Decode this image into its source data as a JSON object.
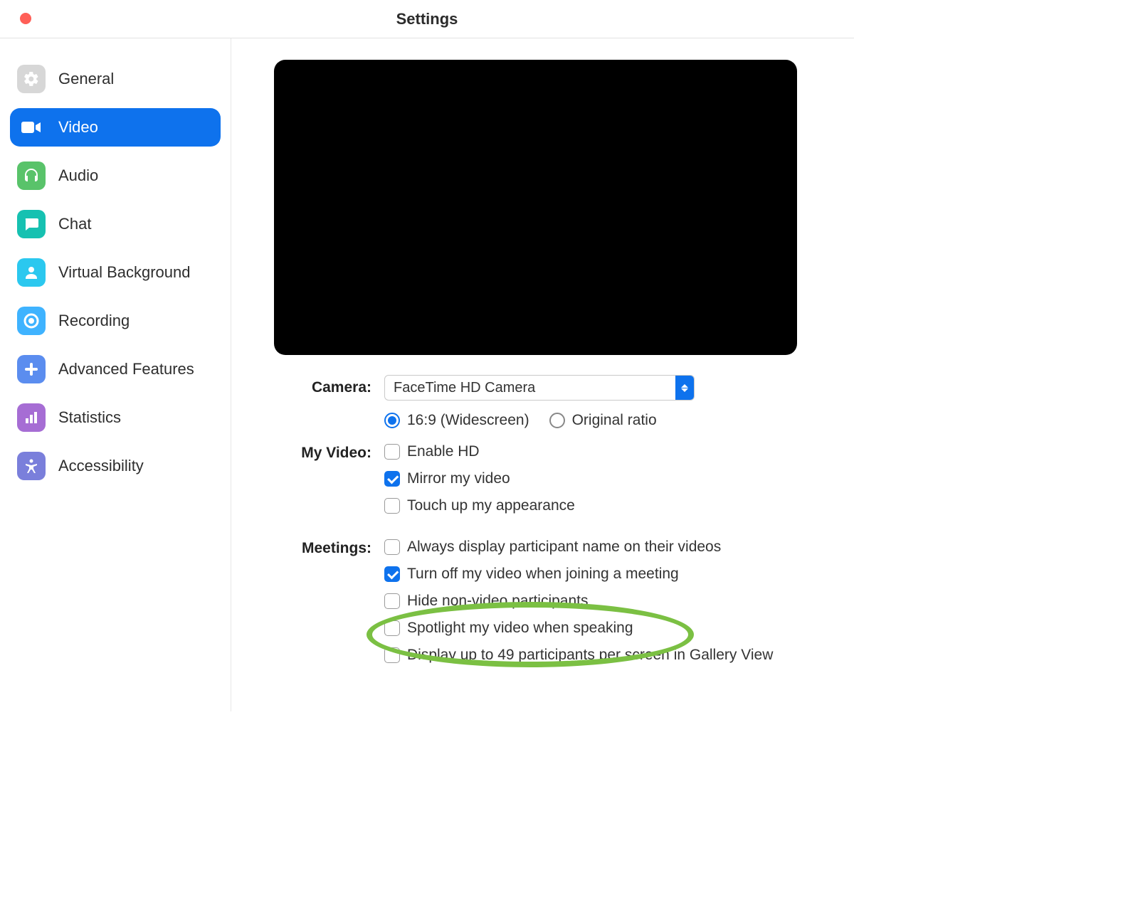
{
  "window": {
    "title": "Settings"
  },
  "sidebar": {
    "items": [
      {
        "label": "General"
      },
      {
        "label": "Video"
      },
      {
        "label": "Audio"
      },
      {
        "label": "Chat"
      },
      {
        "label": "Virtual Background"
      },
      {
        "label": "Recording"
      },
      {
        "label": "Advanced Features"
      },
      {
        "label": "Statistics"
      },
      {
        "label": "Accessibility"
      }
    ]
  },
  "camera": {
    "label": "Camera:",
    "selected": "FaceTime HD Camera",
    "aspect": {
      "widescreen": "16:9 (Widescreen)",
      "original": "Original ratio"
    }
  },
  "myvideo": {
    "label": "My Video:",
    "enable_hd": "Enable HD",
    "mirror": "Mirror my video",
    "touchup": "Touch up my appearance"
  },
  "meetings": {
    "label": "Meetings:",
    "always_name": "Always display participant name on their videos",
    "turn_off": "Turn off my video when joining a meeting",
    "hide_nonvideo": "Hide non-video participants",
    "spotlight": "Spotlight my video when speaking",
    "gallery49": "Display up to 49 participants per screen in Gallery View"
  }
}
